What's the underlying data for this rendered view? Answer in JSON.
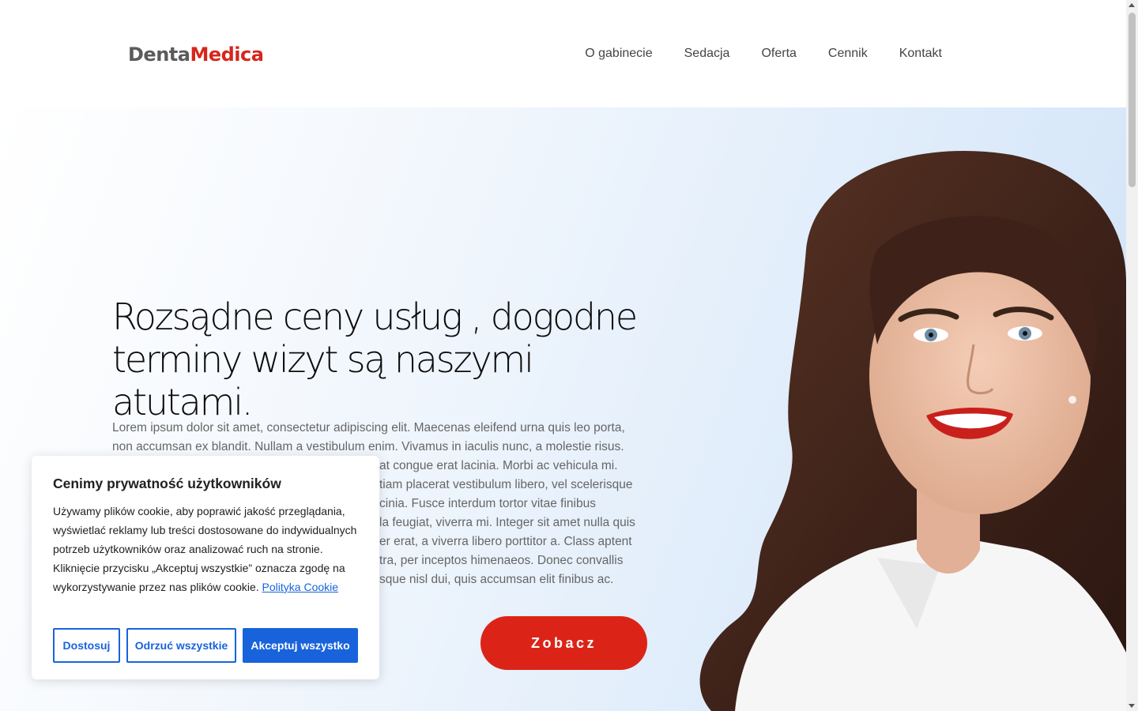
{
  "header": {
    "logo_part1": "Denta",
    "logo_part2": "Medica",
    "nav": [
      "O gabinecie",
      "Sedacja",
      "Oferta",
      "Cennik",
      "Kontakt"
    ]
  },
  "hero": {
    "title_line1": "Rozsądne ceny usług , dogodne",
    "title_line2": "terminy wizyt są naszymi atutami.",
    "text_lines": [
      "Lorem ipsum dolor sit amet, consectetur adipiscing elit. Maecenas eleifend urna quis leo porta,",
      "non accumsan ex blandit. Nullam a vestibulum enim. Vivamus in iaculis nunc, a molestie risus.",
      "at congue erat lacinia. Morbi ac vehicula mi.",
      "tiam placerat vestibulum libero, vel scelerisque",
      "cinia. Fusce interdum tortor vitae finibus",
      "la feugiat, viverra mi. Integer sit amet nulla quis",
      "er erat, a viverra libero porttitor a. Class aptent",
      "tra, per inceptos himenaeos. Donec convallis",
      "sque nisl dui, quis accumsan elit finibus ac."
    ],
    "cta_label": "Zobacz"
  },
  "cookie": {
    "title": "Cenimy prywatność użytkowników",
    "body": "Używamy plików cookie, aby poprawić jakość przeglądania, wyświetlać reklamy lub treści dostosowane do indywidualnych potrzeb użytkowników oraz analizować ruch na stronie. Kliknięcie przycisku „Akceptuj wszystkie” oznacza zgodę na wykorzystywanie przez nas plików cookie.",
    "link": "Polityka Cookie",
    "btn_customize": "Dostosuj",
    "btn_reject": "Odrzuć wszystkie",
    "btn_accept": "Akceptuj wszystko"
  },
  "colors": {
    "brand_red": "#db2417",
    "logo_gray": "#5b5b5b",
    "cookie_blue": "#1863dc"
  }
}
